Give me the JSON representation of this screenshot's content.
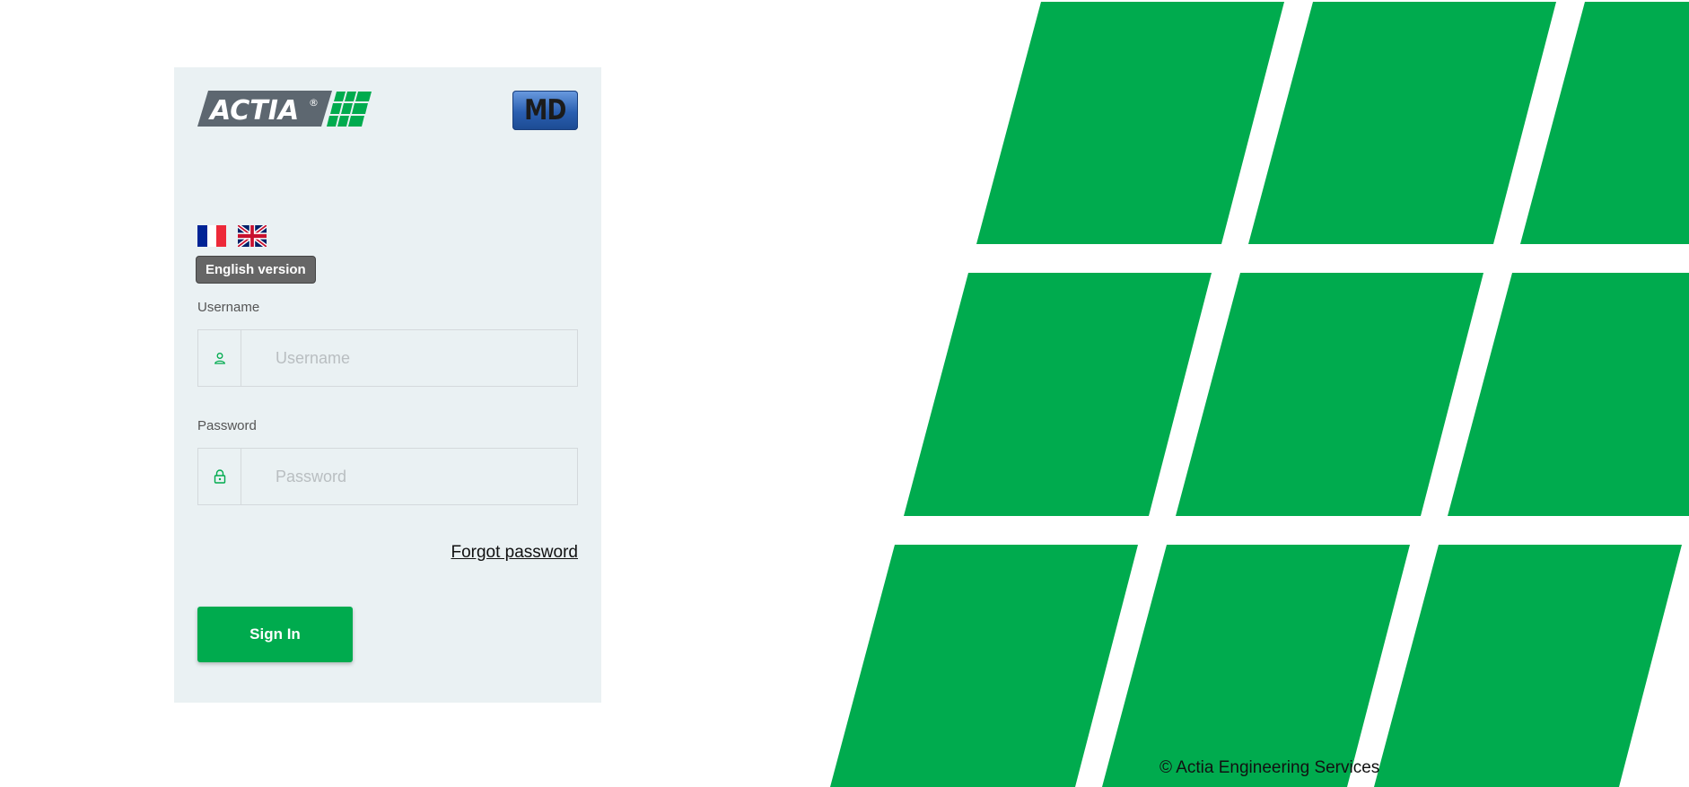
{
  "brand": {
    "actia_logo_text": "ACTIA",
    "md_logo_text": "MD",
    "green": "#00ab4e",
    "card_background": "#eaf1f3"
  },
  "language": {
    "options": [
      {
        "code": "fr",
        "icon": "french-flag-icon"
      },
      {
        "code": "en",
        "icon": "uk-flag-icon"
      }
    ],
    "tooltip": "English version"
  },
  "form": {
    "username_label": "Username",
    "username_placeholder": "Username",
    "username_value": "",
    "username_icon": "user-icon",
    "password_label": "Password",
    "password_placeholder": "Password",
    "password_value": "",
    "password_icon": "lock-icon",
    "forgot_password": "Forgot password",
    "sign_in": "Sign In"
  },
  "footer": {
    "copyright": "© Actia Engineering Services"
  }
}
